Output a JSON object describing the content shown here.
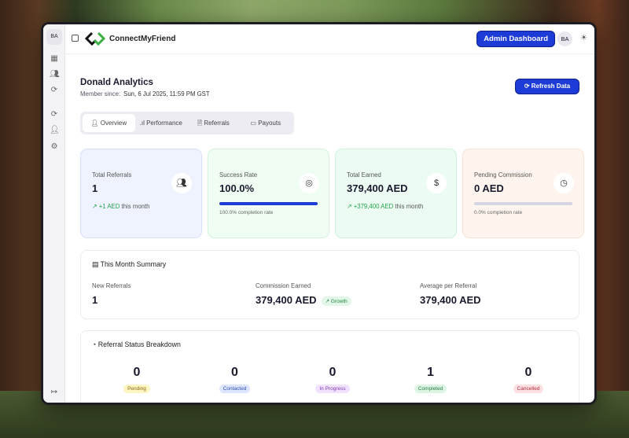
{
  "app": {
    "name": "ConnectMyFriend",
    "admin_button": "Admin Dashboard",
    "user_initials": "BA"
  },
  "sidebar": {
    "initials": "BA"
  },
  "profile": {
    "name": "Donald Analytics",
    "member_since_label": "Member since:",
    "member_since": "Sun, 6 Jul 2025, 11:59 PM GST",
    "refresh": "Refresh Data"
  },
  "tabs": [
    {
      "label": "Overview"
    },
    {
      "label": "Performance"
    },
    {
      "label": "Referrals"
    },
    {
      "label": "Payouts"
    }
  ],
  "cards": [
    {
      "label": "Total Referrals",
      "value": "1",
      "trend": "+1 AED",
      "trend_suffix": "this month"
    },
    {
      "label": "Success Rate",
      "value": "100.0%",
      "progress": 100,
      "sub": "100.0% completion rate"
    },
    {
      "label": "Total Earned",
      "value": "379,400 AED",
      "trend": "+379,400 AED",
      "trend_suffix": "this month"
    },
    {
      "label": "Pending Commission",
      "value": "0 AED",
      "progress": 0,
      "sub": "0.0% completion rate"
    }
  ],
  "summary": {
    "title": "This Month Summary",
    "new_label": "New Referrals",
    "new": "1",
    "comm_label": "Commission Earned",
    "comm": "379,400 AED",
    "growth": "Growth",
    "avg_label": "Average per Referral",
    "avg": "379,400 AED"
  },
  "breakdown": {
    "title": "Referral Status Breakdown",
    "items": [
      {
        "count": "0",
        "label": "Pending",
        "bg": "#fdf6c3",
        "fg": "#8a6a10"
      },
      {
        "count": "0",
        "label": "Contacted",
        "bg": "#dde6ff",
        "fg": "#3350b0"
      },
      {
        "count": "0",
        "label": "In Progress",
        "bg": "#f1e2ff",
        "fg": "#8040b0"
      },
      {
        "count": "1",
        "label": "Completed",
        "bg": "#ddf6e4",
        "fg": "#2a7a44"
      },
      {
        "count": "0",
        "label": "Cancelled",
        "bg": "#fde0e2",
        "fg": "#b03040"
      }
    ]
  }
}
